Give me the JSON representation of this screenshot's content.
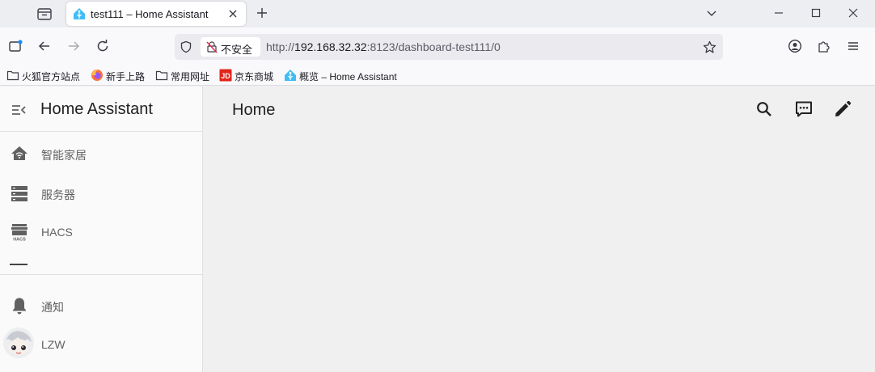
{
  "browser": {
    "tab": {
      "title": "test111 – Home Assistant"
    },
    "url": {
      "insecure_label": "不安全",
      "prefix": "http://",
      "host": "192.168.32.32",
      "rest": ":8123/dashboard-test111/0"
    },
    "bookmarks": [
      {
        "label": "火狐官方站点",
        "icon": "folder-icon"
      },
      {
        "label": "新手上路",
        "icon": "firefox-icon"
      },
      {
        "label": "常用网址",
        "icon": "folder-icon"
      },
      {
        "label": "京东商城",
        "icon": "jd-icon"
      },
      {
        "label": "概览 – Home Assistant",
        "icon": "home-assistant-icon"
      }
    ]
  },
  "ha": {
    "app_title": "Home Assistant",
    "sidebar": {
      "items": [
        {
          "label": "智能家居",
          "icon": "home-icon"
        },
        {
          "label": "服务器",
          "icon": "server-icon"
        },
        {
          "label": "HACS",
          "icon": "hacs-store-icon"
        }
      ],
      "bottom": [
        {
          "label": "通知",
          "icon": "bell-icon"
        },
        {
          "label": "LZW",
          "icon": "avatar"
        }
      ]
    },
    "page_title": "Home"
  },
  "colors": {
    "ha_blue": "#41bdf5",
    "jd_red": "#e1251b"
  }
}
